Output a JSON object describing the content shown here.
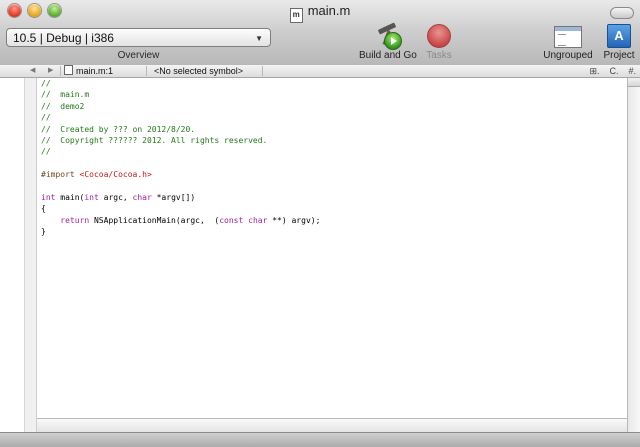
{
  "window": {
    "title": "main.m",
    "file_icon_letter": "m"
  },
  "toolbar": {
    "config_popup": "10.5 | Debug | i386",
    "overview_label": "Overview",
    "build_go_label": "Build and Go",
    "tasks_label": "Tasks",
    "ungrouped_label": "Ungrouped",
    "project_label": "Project",
    "icons": {
      "build_go": "hammer-play-icon",
      "tasks": "stop-icon",
      "ungrouped": "window-layout-icon",
      "project": "app-store-icon"
    }
  },
  "navbar": {
    "file_popup": "main.m:1",
    "symbol_popup": "<No selected symbol>",
    "right_tools": [
      "⊞.",
      "C.",
      "#."
    ]
  },
  "editor": {
    "lines": [
      [
        {
          "t": "//",
          "c": "c-comment"
        }
      ],
      [
        {
          "t": "//  main.m",
          "c": "c-comment"
        }
      ],
      [
        {
          "t": "//  demo2",
          "c": "c-comment"
        }
      ],
      [
        {
          "t": "//",
          "c": "c-comment"
        }
      ],
      [
        {
          "t": "//  Created by ??? on 2012/8/20.",
          "c": "c-comment"
        }
      ],
      [
        {
          "t": "//  Copyright ?????? 2012. All rights reserved.",
          "c": "c-comment"
        }
      ],
      [
        {
          "t": "//",
          "c": "c-comment"
        }
      ],
      [
        {
          "t": "",
          "c": ""
        }
      ],
      [
        {
          "t": "#import ",
          "c": "c-pre"
        },
        {
          "t": "<Cocoa/Cocoa.h>",
          "c": "c-str"
        }
      ],
      [
        {
          "t": "",
          "c": ""
        }
      ],
      [
        {
          "t": "int",
          "c": "c-kw"
        },
        {
          "t": " main(",
          "c": ""
        },
        {
          "t": "int",
          "c": "c-kw"
        },
        {
          "t": " argc, ",
          "c": ""
        },
        {
          "t": "char",
          "c": "c-kw"
        },
        {
          "t": " *argv[])",
          "c": ""
        }
      ],
      [
        {
          "t": "{",
          "c": ""
        }
      ],
      [
        {
          "t": "    ",
          "c": ""
        },
        {
          "t": "return",
          "c": "c-kw"
        },
        {
          "t": " NSApplicationMain(argc,  (",
          "c": ""
        },
        {
          "t": "const",
          "c": "c-kw"
        },
        {
          "t": " ",
          "c": ""
        },
        {
          "t": "char",
          "c": "c-kw"
        },
        {
          "t": " **) argv);",
          "c": ""
        }
      ],
      [
        {
          "t": "}",
          "c": ""
        }
      ]
    ]
  },
  "colors": {
    "comment": "#237a1a",
    "keyword": "#a0229b",
    "preprocessor": "#73451c",
    "string": "#c41a16"
  }
}
